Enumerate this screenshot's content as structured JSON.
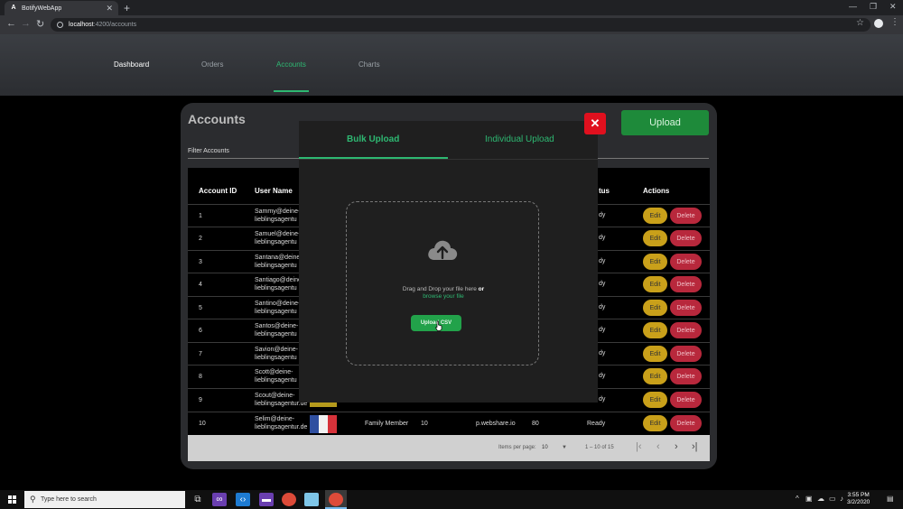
{
  "browser": {
    "tab_title": "BotifyWebApp",
    "tab_favicon": "A",
    "url_host": "localhost",
    "url_path": ":4200/accounts"
  },
  "nav": {
    "items": [
      "Dashboard",
      "Orders",
      "Accounts",
      "Charts"
    ],
    "active": "Accounts"
  },
  "page": {
    "title": "Accounts",
    "upload_label": "Upload",
    "filter_placeholder": "Filter Accounts"
  },
  "table": {
    "headers": [
      "Account ID",
      "User Name",
      "Status",
      "Actions"
    ],
    "header_status_partial": "tus",
    "rows": [
      {
        "id": "1",
        "user1": "Sammy@deine-",
        "user2": "lieblingsagentu",
        "status": "dy"
      },
      {
        "id": "2",
        "user1": "Samuel@deine-",
        "user2": "lieblingsagentu",
        "status": "dy"
      },
      {
        "id": "3",
        "user1": "Santana@deine-",
        "user2": "lieblingsagentu",
        "status": "dy"
      },
      {
        "id": "4",
        "user1": "Santiago@deine",
        "user2": "lieblingsagentu",
        "status": "dy"
      },
      {
        "id": "5",
        "user1": "Santino@deine-",
        "user2": "lieblingsagentu",
        "status": "dy"
      },
      {
        "id": "6",
        "user1": "Santos@deine-",
        "user2": "lieblingsagentu",
        "status": "dy"
      },
      {
        "id": "7",
        "user1": "Savion@deine-",
        "user2": "lieblingsagentu",
        "status": "dy"
      },
      {
        "id": "8",
        "user1": "Scott@deine-",
        "user2": "lieblingsagentu",
        "status": "dy"
      },
      {
        "id": "9",
        "user1": "Scout@deine-",
        "user2": "lieblingsagentur.de",
        "status": "dy"
      }
    ],
    "last_row": {
      "id": "10",
      "user1": "Selim@deine-",
      "user2": "lieblingsagentur.de",
      "role": "Family Member",
      "count": "10",
      "proxy": "p.webshare.io",
      "port": "80",
      "status": "Ready"
    },
    "edit_label": "Edit",
    "delete_label": "Delete"
  },
  "paginator": {
    "items_per_page_label": "Items per page:",
    "items_per_page_value": "10",
    "range": "1 – 10 of 15"
  },
  "modal": {
    "tab_bulk": "Bulk Upload",
    "tab_individual": "Individual Upload",
    "drag_text": "Drag and Drop your file here",
    "or_text": "or",
    "browse_text": "browse your file",
    "upload_csv_label": "Upload CSV",
    "close_symbol": "✕"
  },
  "taskbar": {
    "search_placeholder": "Type here to search",
    "time": "3:55 PM",
    "date": "3/2/2020"
  },
  "colors": {
    "accent_green": "#2eb872",
    "edit_yellow": "#c9a01a",
    "delete_red": "#b8283c",
    "close_red": "#e0101e"
  }
}
